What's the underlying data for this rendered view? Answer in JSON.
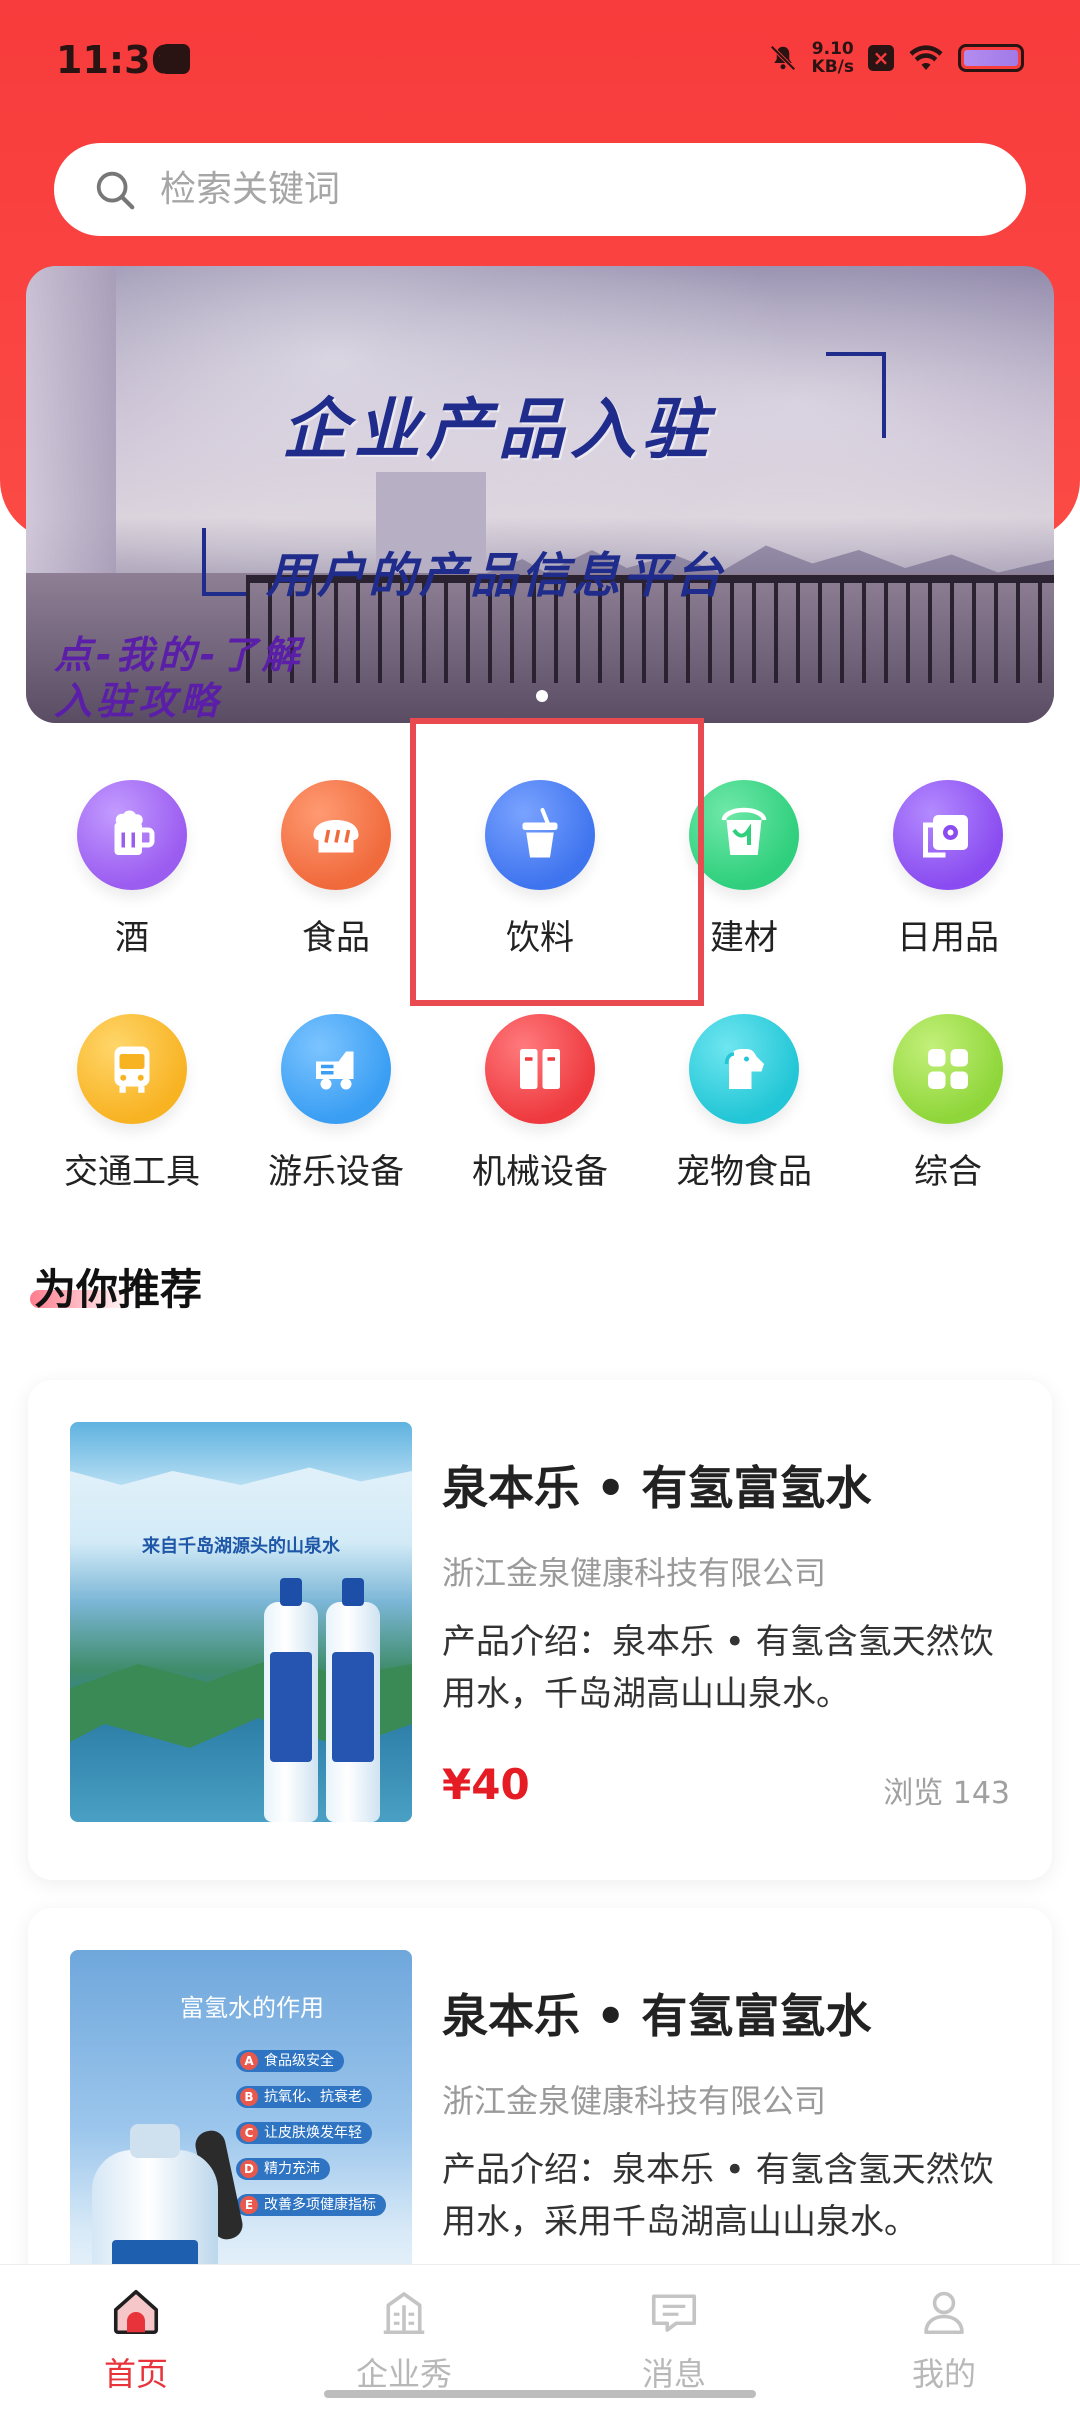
{
  "status_bar": {
    "time": "11:36",
    "net_speed": "9.10",
    "net_unit": "KB/s"
  },
  "search": {
    "placeholder": "检索关键词"
  },
  "banner": {
    "title": "企业产品入驻",
    "subtitle": "用户的产品信息平台",
    "note_line1": "点-我的-了解",
    "note_line2": "入驻攻略"
  },
  "categories": [
    {
      "label": "酒",
      "icon": "beer-mug-icon",
      "color": "#9b5cf0"
    },
    {
      "label": "食品",
      "icon": "bread-icon",
      "color": "#f06a3c"
    },
    {
      "label": "饮料",
      "icon": "drink-cup-icon",
      "color": "#3f74ef"
    },
    {
      "label": "建材",
      "icon": "paint-bucket-icon",
      "color": "#2fcf7d"
    },
    {
      "label": "日用品",
      "icon": "tissue-roll-icon",
      "color": "#8a4cf0"
    },
    {
      "label": "交通工具",
      "icon": "bus-icon",
      "color": "#f8b323"
    },
    {
      "label": "游乐设备",
      "icon": "ride-car-icon",
      "color": "#3a9ef3"
    },
    {
      "label": "机械设备",
      "icon": "machine-icon",
      "color": "#ee3a3f"
    },
    {
      "label": "宠物食品",
      "icon": "dog-icon",
      "color": "#22c6d6"
    },
    {
      "label": "综合",
      "icon": "grid-icon",
      "color": "#8fd63a"
    }
  ],
  "recommend": {
    "title": "为你推荐"
  },
  "products": [
    {
      "name": "泉本乐 • 有氢富氢水",
      "company": "浙江金泉健康科技有限公司",
      "desc": "产品介绍：泉本乐 • 有氢含氢天然饮用水，千岛湖高山山泉水。",
      "price": "¥40",
      "views": "浏览 143",
      "thumb_slogan": "来自千岛湖源头的山泉水"
    },
    {
      "name": "泉本乐 • 有氢富氢水",
      "company": "浙江金泉健康科技有限公司",
      "desc": "产品介绍：泉本乐 • 有氢含氢天然饮用水，采用千岛湖高山山泉水。",
      "thumb_title": "富氢水的作用",
      "thumb_points": [
        {
          "letter": "A",
          "text": "食品级安全"
        },
        {
          "letter": "B",
          "text": "抗氧化、抗衰老"
        },
        {
          "letter": "C",
          "text": "让皮肤焕发年轻"
        },
        {
          "letter": "D",
          "text": "精力充沛"
        },
        {
          "letter": "E",
          "text": "改善多项健康指标"
        }
      ]
    }
  ],
  "tabbar": [
    {
      "label": "首页",
      "icon": "home-icon",
      "active": true
    },
    {
      "label": "企业秀",
      "icon": "building-icon",
      "active": false
    },
    {
      "label": "消息",
      "icon": "message-icon",
      "active": false
    },
    {
      "label": "我的",
      "icon": "user-icon",
      "active": false
    }
  ]
}
